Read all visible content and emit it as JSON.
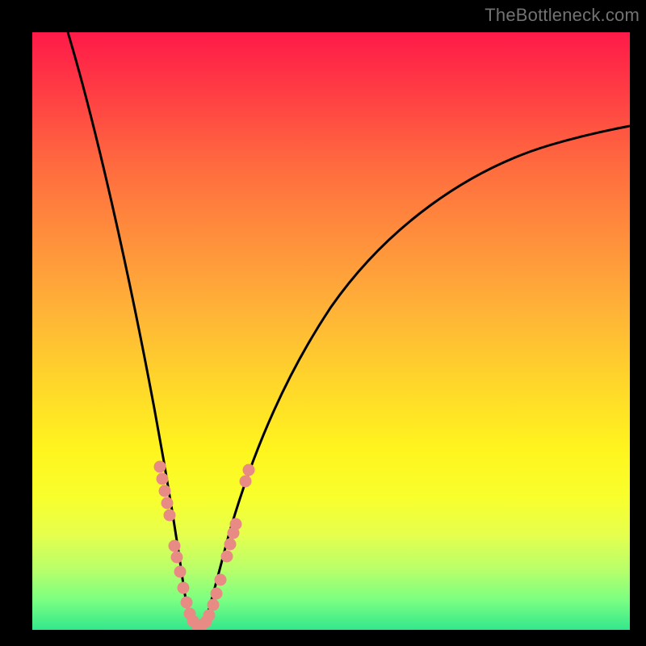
{
  "watermark": "TheBottleneck.com",
  "chart_data": {
    "type": "line",
    "title": "",
    "xlabel": "",
    "ylabel": "",
    "xlim": [
      0,
      100
    ],
    "ylim": [
      0,
      100
    ],
    "grid": false,
    "legend": false,
    "series": [
      {
        "name": "bottleneck-curve-left",
        "color": "#000000",
        "style": "line",
        "x": [
          6,
          8,
          10,
          12,
          14,
          16,
          18,
          20,
          21.5,
          23,
          24,
          25,
          25.8
        ],
        "y": [
          100,
          88,
          77,
          66,
          55,
          44,
          33,
          22,
          14,
          8,
          4,
          1.5,
          0.5
        ]
      },
      {
        "name": "bottleneck-curve-right",
        "color": "#000000",
        "style": "line",
        "x": [
          27.2,
          28,
          30,
          32,
          34,
          37,
          41,
          46,
          52,
          60,
          70,
          82,
          95,
          100
        ],
        "y": [
          0.5,
          1.5,
          5,
          10,
          16,
          24,
          34,
          44,
          53,
          62,
          70,
          76,
          81,
          83
        ]
      },
      {
        "name": "valley-floor",
        "color": "#000000",
        "style": "line",
        "x": [
          25.8,
          27.2
        ],
        "y": [
          0.5,
          0.5
        ]
      },
      {
        "name": "beads-left",
        "color": "#e88b85",
        "style": "scatter",
        "x": [
          20.4,
          20.9,
          21.4,
          22.5,
          22.9,
          23.3,
          23.7,
          24.3,
          24.8,
          25.2,
          25.7,
          26.1,
          26.6,
          27.0
        ],
        "y": [
          27.0,
          24.5,
          22.0,
          14.5,
          12.5,
          10.8,
          9.0,
          6.5,
          4.8,
          3.2,
          2.0,
          1.2,
          0.9,
          0.8
        ]
      },
      {
        "name": "beads-right",
        "color": "#e88b85",
        "style": "scatter",
        "x": [
          27.5,
          28.0,
          28.6,
          29.3,
          29.9,
          30.9,
          31.4,
          31.9,
          32.2,
          33.7,
          34.1
        ],
        "y": [
          0.9,
          1.4,
          2.6,
          4.5,
          6.2,
          10.0,
          12.0,
          13.8,
          14.8,
          24.0,
          26.0
        ]
      }
    ]
  }
}
